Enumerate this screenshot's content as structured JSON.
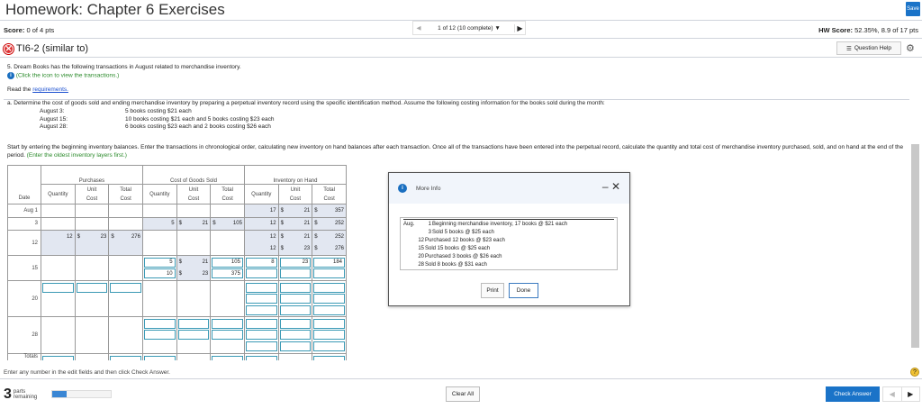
{
  "header": {
    "title": "Homework: Chapter 6 Exercises",
    "save": "Save",
    "score": "Score:",
    "score_value": "0 of 4 pts",
    "pager": "1 of 12 (10 complete) ▼",
    "hw_score": "HW Score:",
    "hw_score_value": "52.35%, 8.9 of 17 pts",
    "question_id": "TI6-2 (similar to)",
    "question_help": "Question Help"
  },
  "question": {
    "intro": "5. Dream Books has the following transactions in August related to merchandise inventory.",
    "click_icon": "(Click the icon to view the transactions.)",
    "read_the": "Read the ",
    "requirements": "requirements.",
    "part_a": "a. Determine the cost of goods sold and ending merchandise inventory by preparing a perpetual inventory record using the specific identification method. Assume the following costing information for the books sold during the month:",
    "costing": [
      {
        "date": "August 3:",
        "text": "5 books costing $21 each"
      },
      {
        "date": "August 15:",
        "text": "10 books costing $21 each and 5 books costing $23 each"
      },
      {
        "date": "August 28:",
        "text": "6 books costing $23 each and 2 books costing $26 each"
      }
    ],
    "instructions": "Start by entering the beginning inventory balances. Enter the transactions in chronological order, calculating new inventory on hand balances after each transaction. Once all of the transactions have been entered into the perpetual record, calculate the quantity and total cost of merchandise inventory purchased, sold, and on hand at the end of the period.",
    "instructions_hint": "(Enter the oldest inventory layers first.)"
  },
  "table": {
    "groups": [
      "Purchases",
      "Cost of Goods Sold",
      "Inventory on Hand"
    ],
    "date_header": "Date",
    "sub_headers": [
      "Quantity",
      "Unit Cost",
      "Total Cost",
      "Quantity",
      "Unit Cost",
      "Total Cost",
      "Quantity",
      "Unit Cost",
      "Total Cost"
    ],
    "rows": [
      {
        "date": "Aug 1",
        "shade": [
          0,
          0,
          1
        ],
        "cells": [
          [],
          [],
          [],
          [],
          [],
          [],
          [
            {
              "v": "17"
            }
          ],
          [
            {
              "c": "$",
              "v": "21"
            }
          ],
          [
            {
              "c": "$",
              "v": "357"
            }
          ]
        ]
      },
      {
        "date": "3",
        "shade": [
          0,
          1,
          1
        ],
        "cells": [
          [],
          [],
          [],
          [
            {
              "v": "5"
            }
          ],
          [
            {
              "c": "$",
              "v": "21"
            }
          ],
          [
            {
              "c": "$",
              "v": "105"
            }
          ],
          [
            {
              "v": "12"
            }
          ],
          [
            {
              "c": "$",
              "v": "21"
            }
          ],
          [
            {
              "c": "$",
              "v": "252"
            }
          ]
        ]
      },
      {
        "date": "12",
        "shade": [
          1,
          0,
          1
        ],
        "cells": [
          [
            {
              "v": "12"
            }
          ],
          [
            {
              "c": "$",
              "v": "23"
            }
          ],
          [
            {
              "c": "$",
              "v": "276"
            }
          ],
          [],
          [],
          [],
          [
            {
              "v": "12"
            },
            {
              "v": "12"
            }
          ],
          [
            {
              "c": "$",
              "v": "21"
            },
            {
              "c": "$",
              "v": "23"
            }
          ],
          [
            {
              "c": "$",
              "v": "252"
            },
            {
              "c": "$",
              "v": "276"
            }
          ]
        ]
      },
      {
        "date": "15",
        "shade": [
          0,
          0,
          0
        ],
        "cells": [
          [],
          [],
          [],
          [
            {
              "i": 1,
              "v": "5"
            },
            {
              "i": 1,
              "v": "10"
            }
          ],
          [
            {
              "c": "$",
              "v": "21",
              "s": 1
            },
            {
              "c": "$",
              "v": "23",
              "s": 1
            }
          ],
          [
            {
              "i": 1,
              "v": "105"
            },
            {
              "i": 1,
              "v": "375"
            }
          ],
          [
            {
              "i": 1,
              "v": "8"
            },
            {
              "i": 1,
              "v": ""
            }
          ],
          [
            {
              "i": 1,
              "v": "23"
            },
            {
              "i": 1,
              "v": ""
            }
          ],
          [
            {
              "i": 1,
              "v": "184"
            },
            {
              "i": 1,
              "v": ""
            }
          ]
        ]
      },
      {
        "date": "20",
        "shade": [
          0,
          0,
          0
        ],
        "cells": [
          [
            {
              "i": 1,
              "v": ""
            }
          ],
          [
            {
              "i": 1,
              "v": ""
            }
          ],
          [
            {
              "i": 1,
              "v": ""
            }
          ],
          [],
          [],
          [],
          [
            {
              "i": 1,
              "v": ""
            },
            {
              "i": 1,
              "v": ""
            },
            {
              "i": 1,
              "v": ""
            }
          ],
          [
            {
              "i": 1,
              "v": ""
            },
            {
              "i": 1,
              "v": ""
            },
            {
              "i": 1,
              "v": ""
            }
          ],
          [
            {
              "i": 1,
              "v": ""
            },
            {
              "i": 1,
              "v": ""
            },
            {
              "i": 1,
              "v": ""
            }
          ]
        ]
      },
      {
        "date": "28",
        "shade": [
          0,
          0,
          0
        ],
        "cells": [
          [],
          [],
          [],
          [
            {
              "i": 1,
              "v": ""
            },
            {
              "i": 1,
              "v": ""
            }
          ],
          [
            {
              "i": 1,
              "v": ""
            },
            {
              "i": 1,
              "v": ""
            }
          ],
          [
            {
              "i": 1,
              "v": ""
            },
            {
              "i": 1,
              "v": ""
            }
          ],
          [
            {
              "i": 1,
              "v": ""
            },
            {
              "i": 1,
              "v": ""
            },
            {
              "i": 1,
              "v": ""
            }
          ],
          [
            {
              "i": 1,
              "v": ""
            },
            {
              "i": 1,
              "v": ""
            },
            {
              "i": 1,
              "v": ""
            }
          ],
          [
            {
              "i": 1,
              "v": ""
            },
            {
              "i": 1,
              "v": ""
            },
            {
              "i": 1,
              "v": ""
            }
          ]
        ]
      },
      {
        "date": "Totals",
        "shade": [
          0,
          0,
          0
        ],
        "cells": [
          [
            {
              "i": 1,
              "v": ""
            }
          ],
          [],
          [
            {
              "i": 1,
              "v": ""
            }
          ],
          [
            {
              "i": 1,
              "v": ""
            }
          ],
          [],
          [
            {
              "i": 1,
              "v": ""
            }
          ],
          [
            {
              "i": 1,
              "v": ""
            }
          ],
          [],
          [
            {
              "i": 1,
              "v": ""
            }
          ]
        ]
      }
    ]
  },
  "modal": {
    "title": "More Info",
    "month": "Aug.",
    "transactions": [
      {
        "day": "1",
        "text": "Beginning merchandise inventory, 17 books @ $21 each"
      },
      {
        "day": "3",
        "text": "Sold 5 books @ $25 each"
      },
      {
        "day": "12",
        "text": "Purchased 12 books @ $23 each"
      },
      {
        "day": "15",
        "text": "Sold 15 books @ $25 each"
      },
      {
        "day": "20",
        "text": "Purchased 3 books @ $26 each"
      },
      {
        "day": "28",
        "text": "Sold 8 books @ $31 each"
      }
    ],
    "print": "Print",
    "done": "Done"
  },
  "footer": {
    "hint": "Enter any number in the edit fields and then click Check Answer.",
    "parts_count": "3",
    "parts_label_1": "parts",
    "parts_label_2": "remaining",
    "progress_percent": 25,
    "clear_all": "Clear All",
    "check_answer": "Check Answer"
  },
  "colors": {
    "accent": "#1a73c8",
    "shade": "#e2e7f1",
    "input_border": "#3b9ab5"
  }
}
